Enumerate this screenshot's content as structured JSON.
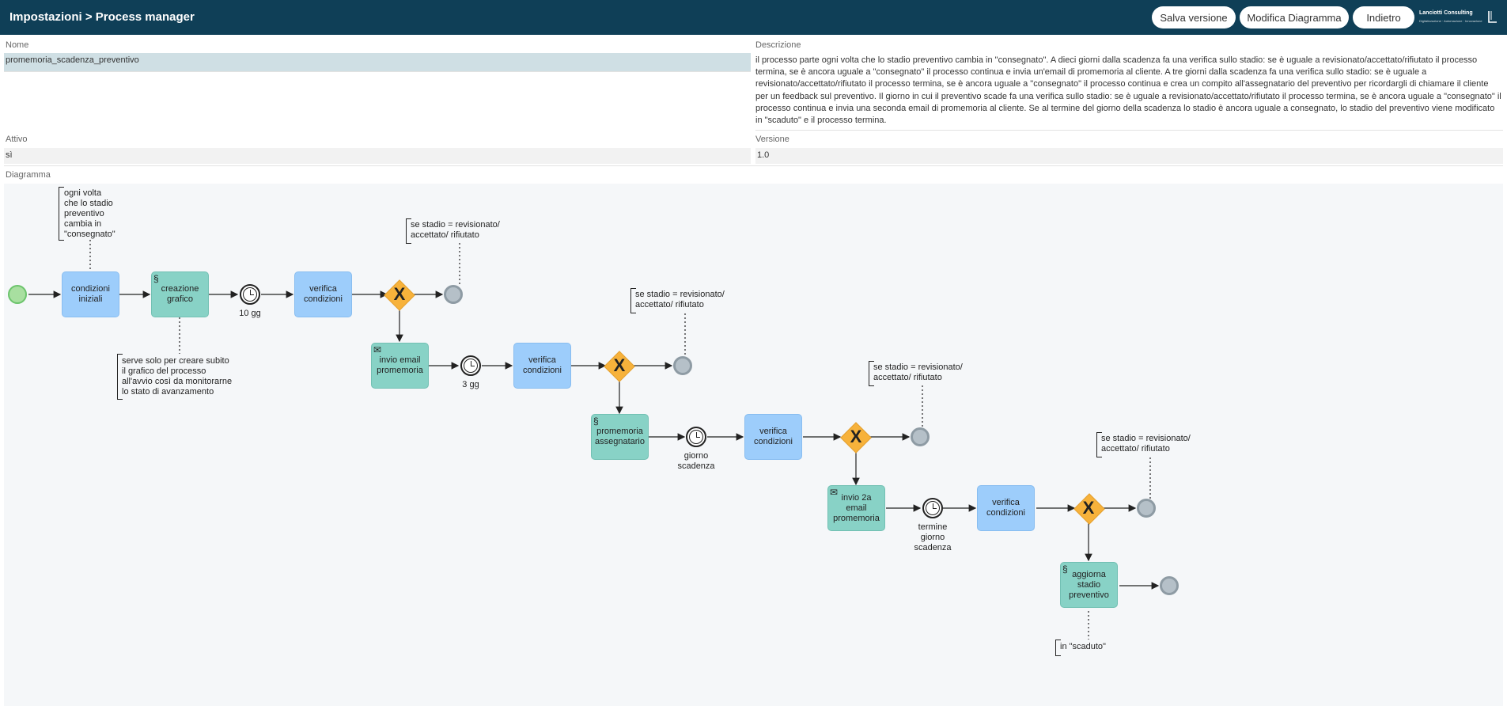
{
  "header": {
    "title": "Impostazioni > Process manager",
    "buttons": {
      "save": "Salva versione",
      "edit": "Modifica Diagramma",
      "back": "Indietro"
    },
    "logo": {
      "name": "Lanciotti Consulting",
      "tagline": "Digitalizzazione · Automazione · Innovazione"
    }
  },
  "form": {
    "name_label": "Nome",
    "name_value": "promemoria_scadenza_preventivo",
    "desc_label": "Descrizione",
    "desc_value": "il processo parte ogni volta che lo stadio preventivo cambia in \"consegnato\". A dieci giorni dalla scadenza fa una verifica sullo stadio: se è uguale a revisionato/accettato/rifiutato il processo termina, se è ancora uguale a \"consegnato\" il processo continua e invia un'email di promemoria al cliente. A tre giorni dalla scadenza fa una verifica sullo stadio: se è uguale a revisionato/accettato/rifiutato il processo termina, se è ancora uguale a \"consegnato\" il processo continua e crea un compito all'assegnatario del preventivo per ricordargli di chiamare il cliente per un feedback sul preventivo. Il giorno in cui il preventivo scade fa una verifica sullo stadio: se è uguale a revisionato/accettato/rifiutato il processo termina, se è ancora uguale a \"consegnato\" il processo continua e invia una seconda email di promemoria al cliente. Se al termine del giorno della scadenza lo stadio è ancora uguale a consegnato, lo stadio del preventivo viene modificato in \"scaduto\" e il processo termina.",
    "active_label": "Attivo",
    "active_value": "sì",
    "version_label": "Versione",
    "version_value": "1.0",
    "diagram_label": "Diagramma"
  },
  "diagram": {
    "tasks": {
      "t1": "condizioni iniziali",
      "t2": "creazione grafico",
      "t3": "verifica condizioni",
      "t4": "invio email promemoria",
      "t5": "verifica condizioni",
      "t6": "promemoria assegnatario",
      "t7": "verifica condizioni",
      "t8": "invio 2a email promemoria",
      "t9": "verifica condizioni",
      "t10": "aggiorna stadio preventivo"
    },
    "timers": {
      "tm1": "10 gg",
      "tm2": "3 gg",
      "tm3": "giorno scadenza",
      "tm4": "termine giorno scadenza"
    },
    "gateway_symbol": "X",
    "annotations": {
      "a1": "ogni volta\nche lo stadio\npreventivo\ncambia in\n\"consegnato\"",
      "a2": "serve solo per creare subito\nil grafico del processo\nall'avvio così da monitorarne\nlo stato di avanzamento",
      "a3": "se stadio = revisionato/\naccettato/ rifiutato",
      "a4": "se stadio = revisionato/\naccettato/ rifiutato",
      "a5": "se stadio = revisionato/\naccettato/ rifiutato",
      "a6": "se stadio = revisionato/\naccettato/ rifiutato",
      "a7": "in \"scaduto\""
    },
    "icons": {
      "script": "script-icon",
      "mail": "envelope-icon",
      "timer": "clock-icon"
    },
    "colors": {
      "blue_task": "#9dcdfb",
      "green_task": "#88d2c6",
      "gateway": "#f7b23b",
      "start": "#a8dfa0",
      "end": "#b5c0c8"
    }
  }
}
